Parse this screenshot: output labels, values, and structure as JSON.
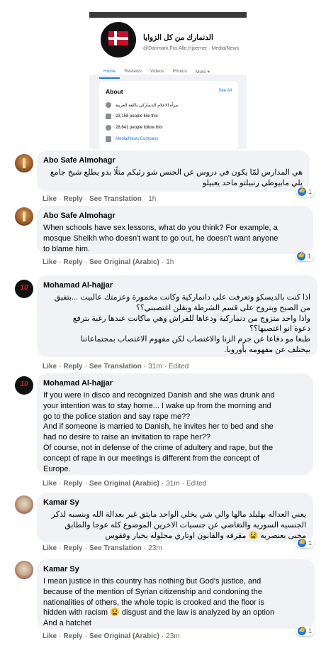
{
  "page": {
    "name": "الدنمارك من كل الزوايا",
    "handle": "@Danmark.Fra.Alle.Hjoerner · Media/News",
    "tabs": [
      "Home",
      "Reviews",
      "Videos",
      "Photos",
      "More ▾"
    ],
    "about": {
      "title": "About",
      "see_all": "See All",
      "description": "مرآة الاعلام الدنماركي باللغة العربية",
      "likes": "23,158 people like this",
      "follows": "28,641 people follow this",
      "category": "Media/News Company"
    }
  },
  "comments": [
    {
      "author": "Abo Safe Almohagr",
      "avatar": "dark-red-building-avatar",
      "lines": [
        "هي المدارس لمّا يكون في دروس عن الجنس شو رئيكم مثلًا بدو يطلع شيخ جامع",
        "يلي مابيوطي زنبيلتو ماحد يعبيلو"
      ],
      "reactions": "1",
      "like": "Like",
      "reply": "Reply",
      "translation": "See Translation",
      "time": "1h",
      "edited": ""
    },
    {
      "author": "Abo Safe Almohagr",
      "avatar": "dark-red-building-avatar",
      "lines": [
        "When schools have sex lessons, what do you think? For example, a",
        "mosque Sheikh who doesn't want to go out, he doesn't want anyone",
        "to blame him."
      ],
      "reactions": "1",
      "like": "Like",
      "reply": "Reply",
      "translation": "See Original (Arabic)",
      "time": "1h",
      "edited": ""
    },
    {
      "author": "Mohamad Al-hajjar",
      "avatar": "black-logo-10-avatar",
      "lines": [
        "اذا كنت بالديسكو وتعرفت على دانماركية وكانت مخمورة وعزمتك عالبيت ...بتفيق",
        "من الصبح وبتروح على قسم الشرطة وبقلن اغتصبني؟؟",
        "واذا واحد متزوج من دنماركية ودعاها للفراش وهي ماكانت عندها رغبة بترفع",
        "دعوة انو اغتصبها؟؟",
        "طبعا مو دفاعا عن جرم الزنا والاغتصاب لكن مفهوم الاغتصاب بمجتماعاتنا",
        "بيختلف عن مفهومه بأوروبا."
      ],
      "reactions": "",
      "like": "Like",
      "reply": "Reply",
      "translation": "See Translation",
      "time": "31m",
      "edited": "Edited"
    },
    {
      "author": "Mohamad Al-hajjar",
      "avatar": "black-logo-10-avatar",
      "lines": [
        "If you were in disco and recognized Danish and she was drunk and",
        "your intention was to stay home... I wake up from the morning and",
        "go to the police station and say rape me??",
        "And if someone is married to Danish, he invites her to bed and she",
        "had no desire to raise an invitation to rape her??",
        "Of course, not in defense of the crime of adultery and rape, but the",
        "concept of rape in our meetings is different from the concept of",
        "Europe."
      ],
      "reactions": "",
      "like": "Like",
      "reply": "Reply",
      "translation": "See Original (Arabic)",
      "time": "31m",
      "edited": "Edited"
    },
    {
      "author": "Kamar Sy",
      "avatar": "portrait-avatar",
      "lines": [
        "يعني العداله بهلبلد مالها والي شي يخلي الواحد مايثق غير بعدالة الله وبنسبه لذكر",
        "الجنسيه السوريه والتغاضي عن جنسيات الاخرين الموضوع كله عوجا والطابق",
        "مخبى بعنصريه 😫 مقرفه والقانون اوتاري محلوله بخيار وفقوس"
      ],
      "reactions": "1",
      "like": "Like",
      "reply": "Reply",
      "translation": "See Translation",
      "time": "23m",
      "edited": ""
    },
    {
      "author": "Kamar Sy",
      "avatar": "portrait-avatar",
      "lines": [
        "I mean justice in this country has nothing but God's justice, and",
        "because of the mention of Syrian citizenship and condoning the",
        "nationalities of others, the whole topic is crooked and the floor is",
        "hidden with racism 😫 disgust and the law is analyzed by an option",
        "And a hatchet"
      ],
      "reactions": "1",
      "like": "Like",
      "reply": "Reply",
      "translation": "See Original (Arabic)",
      "time": "23m",
      "edited": ""
    }
  ]
}
